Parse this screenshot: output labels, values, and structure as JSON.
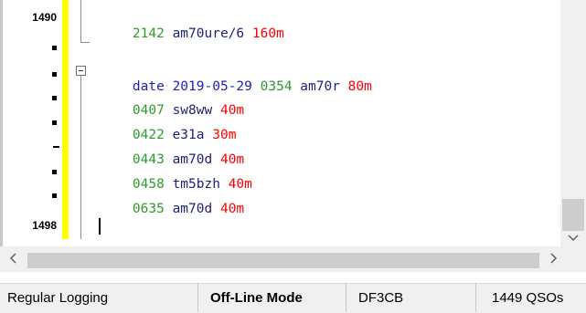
{
  "editor": {
    "gutter": {
      "line_start": "1490",
      "line_end": "1498"
    },
    "lines": [
      {
        "time": "2142",
        "call": "am70ure/6",
        "band": "160m"
      },
      {
        "keyword": "date",
        "date": "2019-05-29",
        "time": "0354",
        "call": "am70r",
        "band": "80m"
      },
      {
        "time": "0407",
        "call": "sw8ww",
        "band": "40m"
      },
      {
        "time": "0422",
        "call": "e31a",
        "band": "30m"
      },
      {
        "time": "0443",
        "call": "am70d",
        "band": "40m"
      },
      {
        "time": "0458",
        "call": "tm5bzh",
        "band": "40m"
      },
      {
        "time": "0635",
        "call": "am70d",
        "band": "40m"
      }
    ]
  },
  "scrollbars": {
    "left_arrow": "<",
    "right_arrow": ">",
    "down_arrow": "v"
  },
  "statusbar": {
    "mode": "Regular Logging",
    "connection": "Off-Line Mode",
    "callsign": "DF3CB",
    "qso_count": "1449 QSOs"
  },
  "colors": {
    "time": "#2e9a2e",
    "call": "#1f1f7a",
    "band": "#ff0000",
    "date_keyword": "#1f1fb8",
    "gutter_highlight": "#ffff00"
  }
}
